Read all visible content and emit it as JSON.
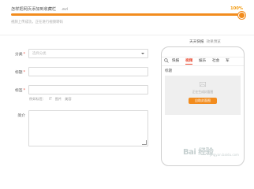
{
  "upload": {
    "title": "怎样把网页添加到收藏栏",
    "extension": ".avi",
    "percent_label": "100%",
    "progress": 1.0,
    "status": "视频上传成功，正在进行视频转码"
  },
  "form": {
    "category": {
      "label": "分类",
      "required": "*",
      "placeholder": "选择分类"
    },
    "title": {
      "label": "标题",
      "required": "*"
    },
    "tags": {
      "label": "标签",
      "required": "*",
      "hint_prefix": "例如标签：",
      "hint_items": [
        "IT",
        "图片",
        "美容"
      ]
    },
    "intro": {
      "label": "简介"
    }
  },
  "preview": {
    "header_name": "天天快报",
    "header_suffix": "效果预览",
    "tabs": [
      "快报",
      "视频",
      "娱乐",
      "社会",
      "军"
    ],
    "active_tab_index": 1,
    "section_title": "标题",
    "placeholder_text": "正在生成封面图",
    "upload_button_label": "自助封面图"
  },
  "watermark": {
    "brand": "Bai 经验",
    "sub": "jingyan.baidu.com"
  },
  "colors": {
    "accent": "#f28c1e",
    "active_tab": "#e8452c",
    "required": "#e74c3c"
  }
}
